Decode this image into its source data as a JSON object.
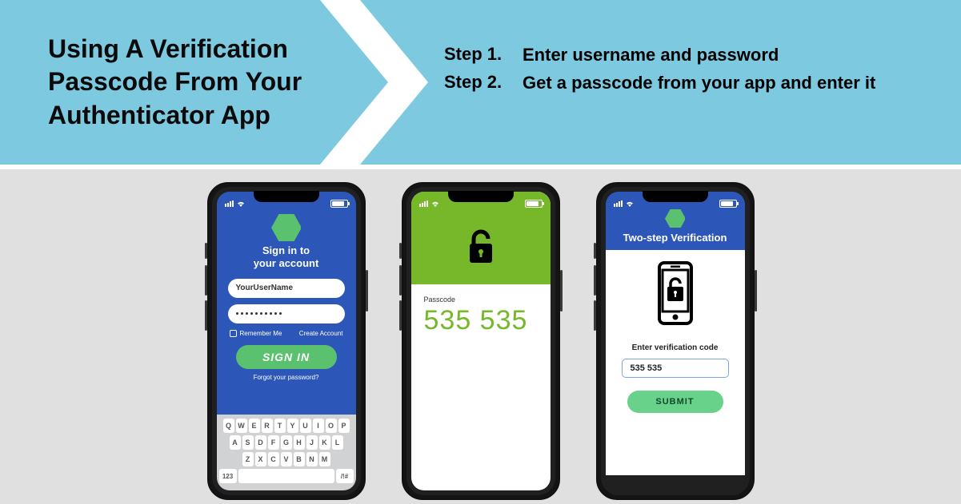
{
  "banner": {
    "title_l1": "Using A Verification",
    "title_l2": "Passcode From Your",
    "title_l3": "Authenticator App"
  },
  "steps": [
    {
      "num": "Step 1.",
      "text": "Enter username and password"
    },
    {
      "num": "Step 2.",
      "text": "Get a passcode from your app and enter it"
    }
  ],
  "phone1": {
    "title_l1": "Sign in to",
    "title_l2": "your account",
    "username": "YourUserName",
    "password_dots": 10,
    "remember": "Remember Me",
    "create": "Create Account",
    "signin": "SIGN IN",
    "forgot": "Forgot your password?",
    "keyboard": {
      "row1": [
        "Q",
        "W",
        "E",
        "R",
        "T",
        "Y",
        "U",
        "I",
        "O",
        "P"
      ],
      "row2": [
        "A",
        "S",
        "D",
        "F",
        "G",
        "H",
        "J",
        "K",
        "L"
      ],
      "row3": [
        "Z",
        "X",
        "C",
        "V",
        "B",
        "N",
        "M"
      ],
      "num": "123",
      "alt": "/!#"
    }
  },
  "phone2": {
    "passcode_label": "Passcode",
    "passcode_value": "535 535"
  },
  "phone3": {
    "title": "Two-step Verification",
    "enter_label": "Enter verification code",
    "code_value": "535 535",
    "submit": "SUBMIT"
  },
  "colors": {
    "banner": "#7cc9e0",
    "blue": "#2c56b8",
    "green_btn": "#5ac16e",
    "green_top": "#76b82a",
    "submit": "#68d28a"
  }
}
